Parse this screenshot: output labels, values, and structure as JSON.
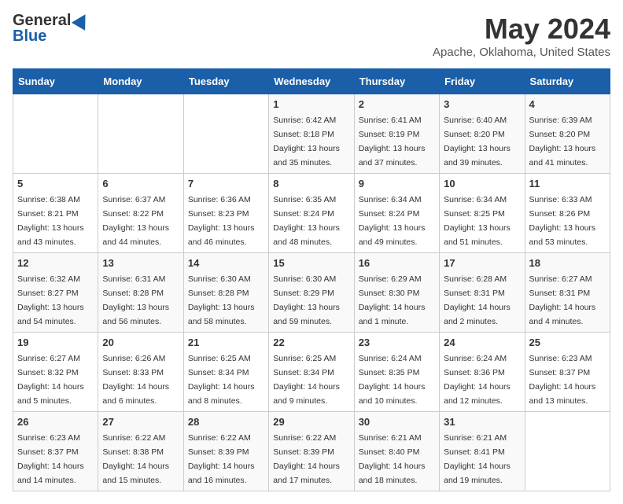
{
  "logo": {
    "general": "General",
    "blue": "Blue"
  },
  "title": {
    "month_year": "May 2024",
    "location": "Apache, Oklahoma, United States"
  },
  "days_of_week": [
    "Sunday",
    "Monday",
    "Tuesday",
    "Wednesday",
    "Thursday",
    "Friday",
    "Saturday"
  ],
  "weeks": [
    [
      {
        "day": "",
        "info": ""
      },
      {
        "day": "",
        "info": ""
      },
      {
        "day": "",
        "info": ""
      },
      {
        "day": "1",
        "info": "Sunrise: 6:42 AM\nSunset: 8:18 PM\nDaylight: 13 hours and 35 minutes."
      },
      {
        "day": "2",
        "info": "Sunrise: 6:41 AM\nSunset: 8:19 PM\nDaylight: 13 hours and 37 minutes."
      },
      {
        "day": "3",
        "info": "Sunrise: 6:40 AM\nSunset: 8:20 PM\nDaylight: 13 hours and 39 minutes."
      },
      {
        "day": "4",
        "info": "Sunrise: 6:39 AM\nSunset: 8:20 PM\nDaylight: 13 hours and 41 minutes."
      }
    ],
    [
      {
        "day": "5",
        "info": "Sunrise: 6:38 AM\nSunset: 8:21 PM\nDaylight: 13 hours and 43 minutes."
      },
      {
        "day": "6",
        "info": "Sunrise: 6:37 AM\nSunset: 8:22 PM\nDaylight: 13 hours and 44 minutes."
      },
      {
        "day": "7",
        "info": "Sunrise: 6:36 AM\nSunset: 8:23 PM\nDaylight: 13 hours and 46 minutes."
      },
      {
        "day": "8",
        "info": "Sunrise: 6:35 AM\nSunset: 8:24 PM\nDaylight: 13 hours and 48 minutes."
      },
      {
        "day": "9",
        "info": "Sunrise: 6:34 AM\nSunset: 8:24 PM\nDaylight: 13 hours and 49 minutes."
      },
      {
        "day": "10",
        "info": "Sunrise: 6:34 AM\nSunset: 8:25 PM\nDaylight: 13 hours and 51 minutes."
      },
      {
        "day": "11",
        "info": "Sunrise: 6:33 AM\nSunset: 8:26 PM\nDaylight: 13 hours and 53 minutes."
      }
    ],
    [
      {
        "day": "12",
        "info": "Sunrise: 6:32 AM\nSunset: 8:27 PM\nDaylight: 13 hours and 54 minutes."
      },
      {
        "day": "13",
        "info": "Sunrise: 6:31 AM\nSunset: 8:28 PM\nDaylight: 13 hours and 56 minutes."
      },
      {
        "day": "14",
        "info": "Sunrise: 6:30 AM\nSunset: 8:28 PM\nDaylight: 13 hours and 58 minutes."
      },
      {
        "day": "15",
        "info": "Sunrise: 6:30 AM\nSunset: 8:29 PM\nDaylight: 13 hours and 59 minutes."
      },
      {
        "day": "16",
        "info": "Sunrise: 6:29 AM\nSunset: 8:30 PM\nDaylight: 14 hours and 1 minute."
      },
      {
        "day": "17",
        "info": "Sunrise: 6:28 AM\nSunset: 8:31 PM\nDaylight: 14 hours and 2 minutes."
      },
      {
        "day": "18",
        "info": "Sunrise: 6:27 AM\nSunset: 8:31 PM\nDaylight: 14 hours and 4 minutes."
      }
    ],
    [
      {
        "day": "19",
        "info": "Sunrise: 6:27 AM\nSunset: 8:32 PM\nDaylight: 14 hours and 5 minutes."
      },
      {
        "day": "20",
        "info": "Sunrise: 6:26 AM\nSunset: 8:33 PM\nDaylight: 14 hours and 6 minutes."
      },
      {
        "day": "21",
        "info": "Sunrise: 6:25 AM\nSunset: 8:34 PM\nDaylight: 14 hours and 8 minutes."
      },
      {
        "day": "22",
        "info": "Sunrise: 6:25 AM\nSunset: 8:34 PM\nDaylight: 14 hours and 9 minutes."
      },
      {
        "day": "23",
        "info": "Sunrise: 6:24 AM\nSunset: 8:35 PM\nDaylight: 14 hours and 10 minutes."
      },
      {
        "day": "24",
        "info": "Sunrise: 6:24 AM\nSunset: 8:36 PM\nDaylight: 14 hours and 12 minutes."
      },
      {
        "day": "25",
        "info": "Sunrise: 6:23 AM\nSunset: 8:37 PM\nDaylight: 14 hours and 13 minutes."
      }
    ],
    [
      {
        "day": "26",
        "info": "Sunrise: 6:23 AM\nSunset: 8:37 PM\nDaylight: 14 hours and 14 minutes."
      },
      {
        "day": "27",
        "info": "Sunrise: 6:22 AM\nSunset: 8:38 PM\nDaylight: 14 hours and 15 minutes."
      },
      {
        "day": "28",
        "info": "Sunrise: 6:22 AM\nSunset: 8:39 PM\nDaylight: 14 hours and 16 minutes."
      },
      {
        "day": "29",
        "info": "Sunrise: 6:22 AM\nSunset: 8:39 PM\nDaylight: 14 hours and 17 minutes."
      },
      {
        "day": "30",
        "info": "Sunrise: 6:21 AM\nSunset: 8:40 PM\nDaylight: 14 hours and 18 minutes."
      },
      {
        "day": "31",
        "info": "Sunrise: 6:21 AM\nSunset: 8:41 PM\nDaylight: 14 hours and 19 minutes."
      },
      {
        "day": "",
        "info": ""
      }
    ]
  ]
}
